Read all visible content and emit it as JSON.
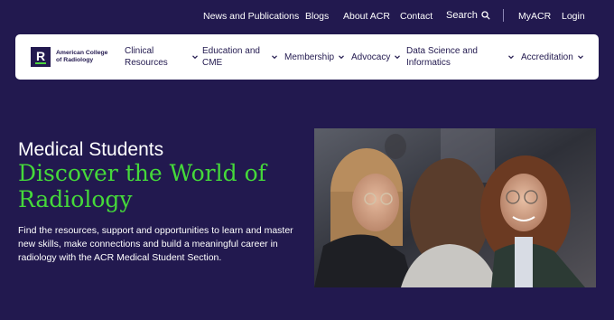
{
  "utility_nav": {
    "news": "News and Publications",
    "blogs": "Blogs",
    "about": "About ACR",
    "contact": "Contact",
    "search": "Search",
    "myacr": "MyACR",
    "login": "Login"
  },
  "logo": {
    "line1": "American College",
    "line2": "of Radiology"
  },
  "main_nav": {
    "items": [
      {
        "label": "Clinical Resources"
      },
      {
        "label": "Education and CME"
      },
      {
        "label": "Membership"
      },
      {
        "label": "Advocacy"
      },
      {
        "label": "Data Science and Informatics"
      },
      {
        "label": "Accreditation"
      }
    ]
  },
  "hero": {
    "kicker": "Medical Students",
    "title": "Discover the World of Radiology",
    "description": "Find the resources, support and opportunities to learn and master new skills, make connections and build a meaningful career in radiology with the ACR Medical Student Section."
  },
  "colors": {
    "background": "#22194f",
    "accent_green": "#45d93a",
    "nav_bg": "#ffffff"
  },
  "icons": {
    "search": "search-icon",
    "chevron": "chevron-down-icon"
  }
}
